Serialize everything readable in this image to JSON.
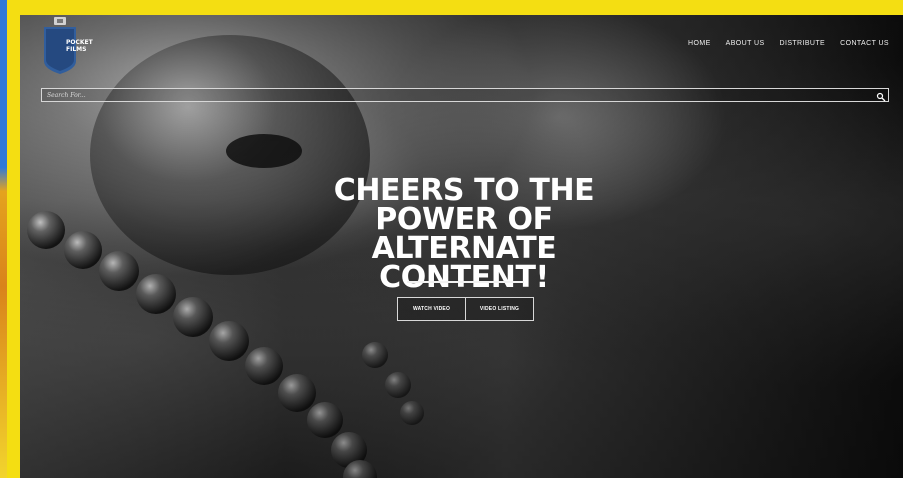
{
  "logo": {
    "line1": "POCKET",
    "line2": "FILMS",
    "colors": {
      "badge": "#315e9d",
      "badge_dark": "#1b3868",
      "clip": "#d2d2d2"
    }
  },
  "nav": {
    "items": [
      {
        "label": "HOME"
      },
      {
        "label": "ABOUT US"
      },
      {
        "label": "DISTRIBUTE"
      },
      {
        "label": "CONTACT US"
      }
    ]
  },
  "search": {
    "placeholder": "Search For...",
    "icon": "search-icon"
  },
  "hero": {
    "title": "CHEERS TO THE POWER OF ALTERNATE CONTENT!",
    "buttons": [
      {
        "label": "WATCH VIDEO"
      },
      {
        "label": "VIDEO LISTING"
      }
    ]
  },
  "colors": {
    "frame": "#f4de12",
    "text": "#ffffff",
    "line": "#f2f2f2"
  }
}
